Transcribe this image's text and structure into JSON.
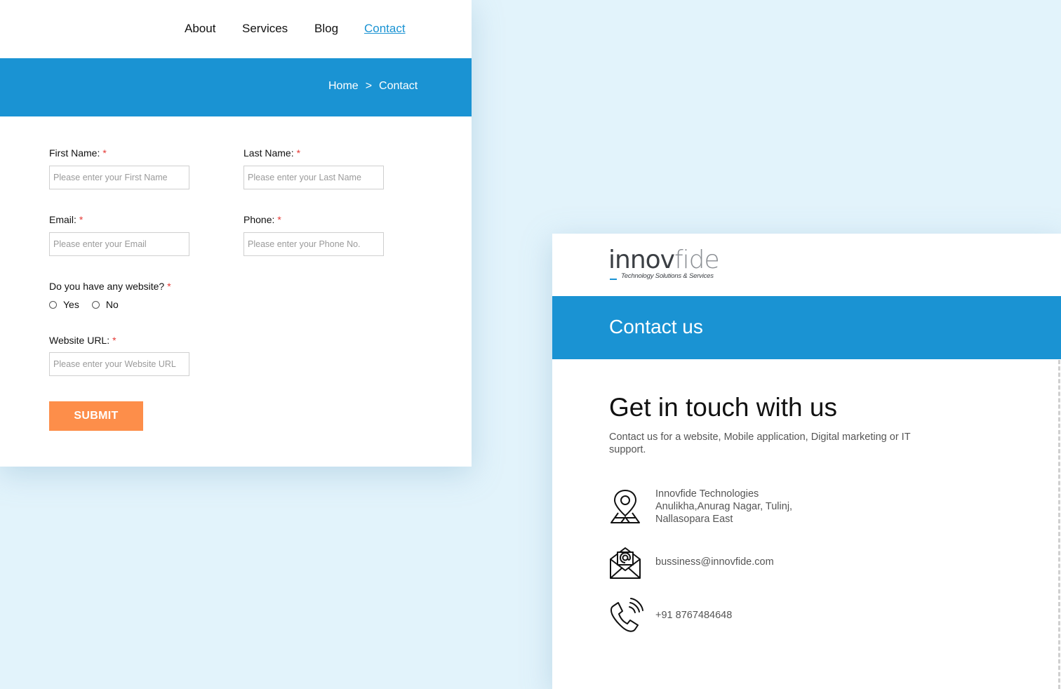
{
  "nav": {
    "items": [
      {
        "label": "About",
        "active": false
      },
      {
        "label": "Services",
        "active": false
      },
      {
        "label": "Blog",
        "active": false
      },
      {
        "label": "Contact",
        "active": true
      }
    ]
  },
  "breadcrumb": {
    "home": "Home",
    "separator": ">",
    "current": "Contact"
  },
  "form": {
    "first_name": {
      "label": "First Name:",
      "required_mark": "*",
      "placeholder": "Please enter your First Name",
      "value": ""
    },
    "last_name": {
      "label": "Last Name:",
      "required_mark": "*",
      "placeholder": "Please enter your Last Name",
      "value": ""
    },
    "email": {
      "label": "Email:",
      "required_mark": "*",
      "placeholder": "Please enter your Email",
      "value": ""
    },
    "phone": {
      "label": "Phone:",
      "required_mark": "*",
      "placeholder": "Please enter your Phone No.",
      "value": ""
    },
    "website_question": {
      "label": "Do you have any website?",
      "required_mark": "*",
      "options": [
        "Yes",
        "No"
      ],
      "selected": null
    },
    "website_url": {
      "label": "Website URL:",
      "required_mark": "*",
      "placeholder": "Please enter your Website URL",
      "value": ""
    },
    "submit_label": "SUBMIT"
  },
  "brand": {
    "name_part1": "innov",
    "name_part2": "fide",
    "tagline": "Technology Solutions & Services"
  },
  "contact_card": {
    "header": "Contact us",
    "heading": "Get in touch with us",
    "subtext": "Contact us for a website, Mobile application, Digital marketing or IT support.",
    "address": {
      "line1": "Innovfide Technologies",
      "line2": "Anulikha,Anurag Nagar, Tulinj,",
      "line3": "Nallasopara East",
      "icon": "location-map-icon"
    },
    "email": {
      "value": "bussiness@innovfide.com",
      "icon": "envelope-at-icon"
    },
    "phone": {
      "value": "+91 8767484648",
      "icon": "phone-ringing-icon"
    }
  },
  "colors": {
    "primary": "#1a93d3",
    "accent": "#fd8e4a",
    "background": "#e2f3fb",
    "required": "#e53935"
  }
}
